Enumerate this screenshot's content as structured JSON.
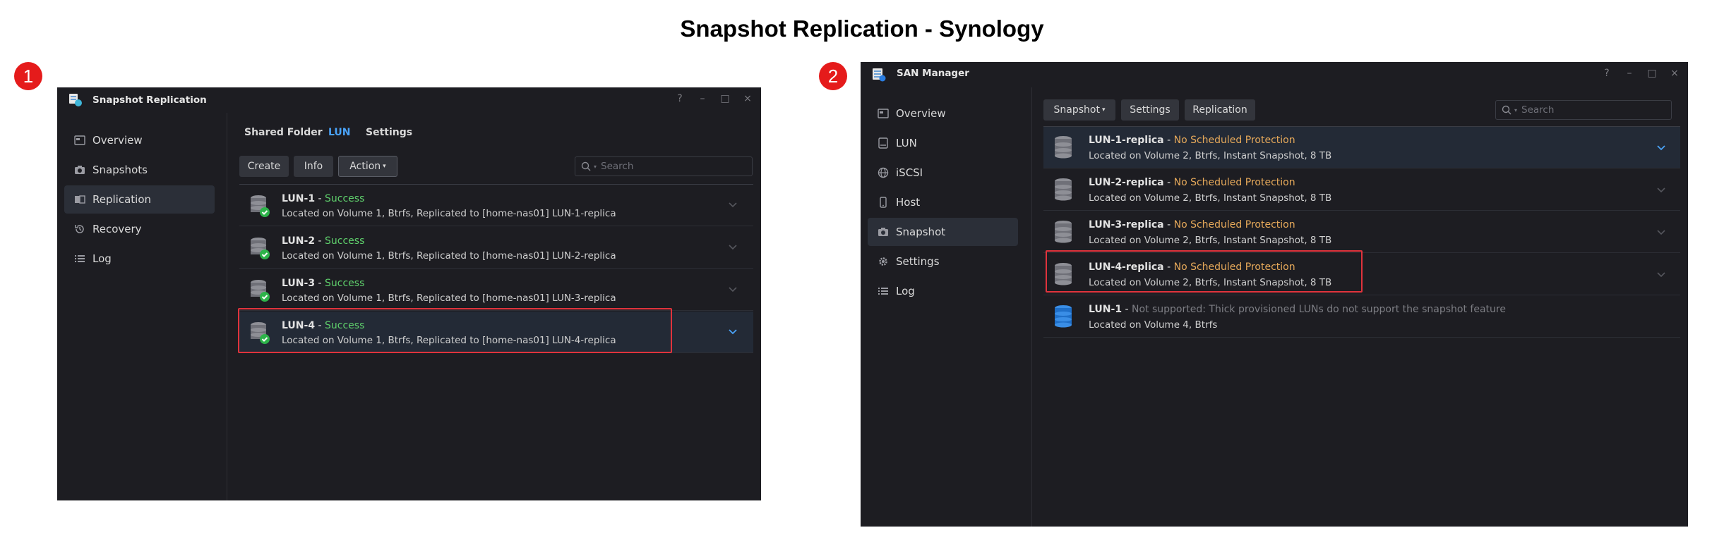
{
  "page_title": "Snapshot Replication - Synology",
  "badges": [
    "1",
    "2"
  ],
  "win1": {
    "title": "Snapshot Replication",
    "controls": [
      "?",
      "–",
      "□",
      "×"
    ],
    "nav": [
      {
        "label": "Overview",
        "icon": "overview-icon"
      },
      {
        "label": "Snapshots",
        "icon": "camera-icon"
      },
      {
        "label": "Replication",
        "icon": "replication-icon",
        "active": true
      },
      {
        "label": "Recovery",
        "icon": "recovery-icon"
      },
      {
        "label": "Log",
        "icon": "list-icon"
      }
    ],
    "tabs": [
      "Shared Folder",
      "LUN",
      "Settings"
    ],
    "buttons": {
      "create": "Create",
      "info": "Info",
      "action": "Action"
    },
    "search_placeholder": "Search",
    "rows": [
      {
        "name": "LUN-1",
        "sep": " - ",
        "status": "Success",
        "desc": "Located on Volume 1, Btrfs, Replicated to [home-nas01] LUN-1-replica"
      },
      {
        "name": "LUN-2",
        "sep": " - ",
        "status": "Success",
        "desc": "Located on Volume 1, Btrfs, Replicated to [home-nas01] LUN-2-replica"
      },
      {
        "name": "LUN-3",
        "sep": " - ",
        "status": "Success",
        "desc": "Located on Volume 1, Btrfs, Replicated to [home-nas01] LUN-3-replica"
      },
      {
        "name": "LUN-4",
        "sep": " - ",
        "status": "Success",
        "desc": "Located on Volume 1, Btrfs, Replicated to [home-nas01] LUN-4-replica"
      }
    ]
  },
  "win2": {
    "title": "SAN Manager",
    "controls": [
      "?",
      "–",
      "□",
      "×"
    ],
    "nav": [
      {
        "label": "Overview",
        "icon": "overview-icon"
      },
      {
        "label": "LUN",
        "icon": "lun-icon"
      },
      {
        "label": "iSCSI",
        "icon": "globe-icon"
      },
      {
        "label": "Host",
        "icon": "phone-icon"
      },
      {
        "label": "Snapshot",
        "icon": "camera-icon",
        "active": true
      },
      {
        "label": "Settings",
        "icon": "gear-icon"
      },
      {
        "label": "Log",
        "icon": "list-icon"
      }
    ],
    "buttons": {
      "snapshot": "Snapshot",
      "settings": "Settings",
      "replication": "Replication"
    },
    "search_placeholder": "Search",
    "rows": [
      {
        "name": "LUN-1-replica",
        "sep": " - ",
        "status": "No Scheduled Protection",
        "desc": "Located on Volume 2, Btrfs, Instant Snapshot, 8 TB"
      },
      {
        "name": "LUN-2-replica",
        "sep": " - ",
        "status": "No Scheduled Protection",
        "desc": "Located on Volume 2, Btrfs, Instant Snapshot, 8 TB"
      },
      {
        "name": "LUN-3-replica",
        "sep": " - ",
        "status": "No Scheduled Protection",
        "desc": "Located on Volume 2, Btrfs, Instant Snapshot, 8 TB"
      },
      {
        "name": "LUN-4-replica",
        "sep": " - ",
        "status": "No Scheduled Protection",
        "desc": "Located on Volume 2, Btrfs, Instant Snapshot, 8 TB"
      },
      {
        "name": "LUN-1",
        "sep": " - ",
        "status": "Not supported: Thick provisioned LUNs do not support the snapshot feature",
        "desc": "Located on Volume 4, Btrfs"
      }
    ]
  },
  "colors": {
    "success": "#5fd06c",
    "warning": "#e6a95a",
    "accent": "#4aa3f8",
    "highlight": "#e0333c",
    "badge": "#e51b1b"
  }
}
